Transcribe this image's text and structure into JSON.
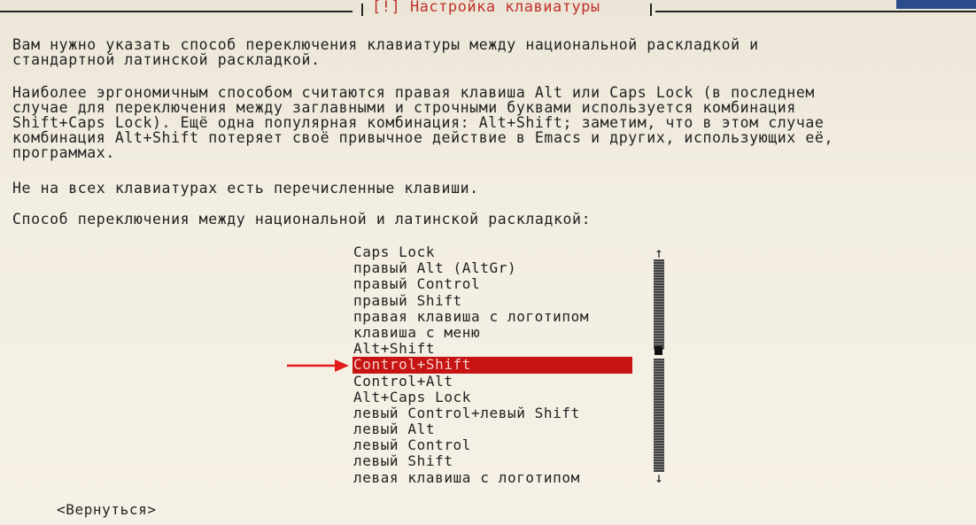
{
  "dialog": {
    "title": "[!] Настройка клавиатуры"
  },
  "text": {
    "p1": "Вам нужно указать способ переключения клавиатуры между национальной раскладкой и\nстандартной латинской раскладкой.",
    "p2": "Наиболее эргономичным способом считаются правая клавиша Alt или Caps Lock (в последнем\nслучае для переключения между заглавными и строчными буквами используется комбинация\nShift+Caps Lock). Ещё одна популярная комбинация: Alt+Shift; заметим, что в этом случае\nкомбинация Alt+Shift потеряет своё привычное действие в Emacs и других, использующих её,\nпрограммах.",
    "p3": "Не на всех клавиатурах есть перечисленные клавиши.",
    "prompt": "Способ переключения между национальной и латинской раскладкой:"
  },
  "options": [
    "Caps Lock",
    "правый Alt (AltGr)",
    "правый Control",
    "правый Shift",
    "правая клавиша с логотипом",
    "клавиша с меню",
    "Alt+Shift",
    "Control+Shift",
    "Control+Alt",
    "Alt+Caps Lock",
    "левый Control+левый Shift",
    "левый Alt",
    "левый Control",
    "левый Shift",
    "левая клавиша с логотипом"
  ],
  "selected_option": "Control+Shift",
  "scroll": {
    "up_arrow": "↑",
    "down_arrow": "↓"
  },
  "back_button": "<Вернуться>",
  "colors": {
    "selection": "#c61414",
    "title": "#c0322a",
    "pointer_arrow": "#e21b1b"
  }
}
